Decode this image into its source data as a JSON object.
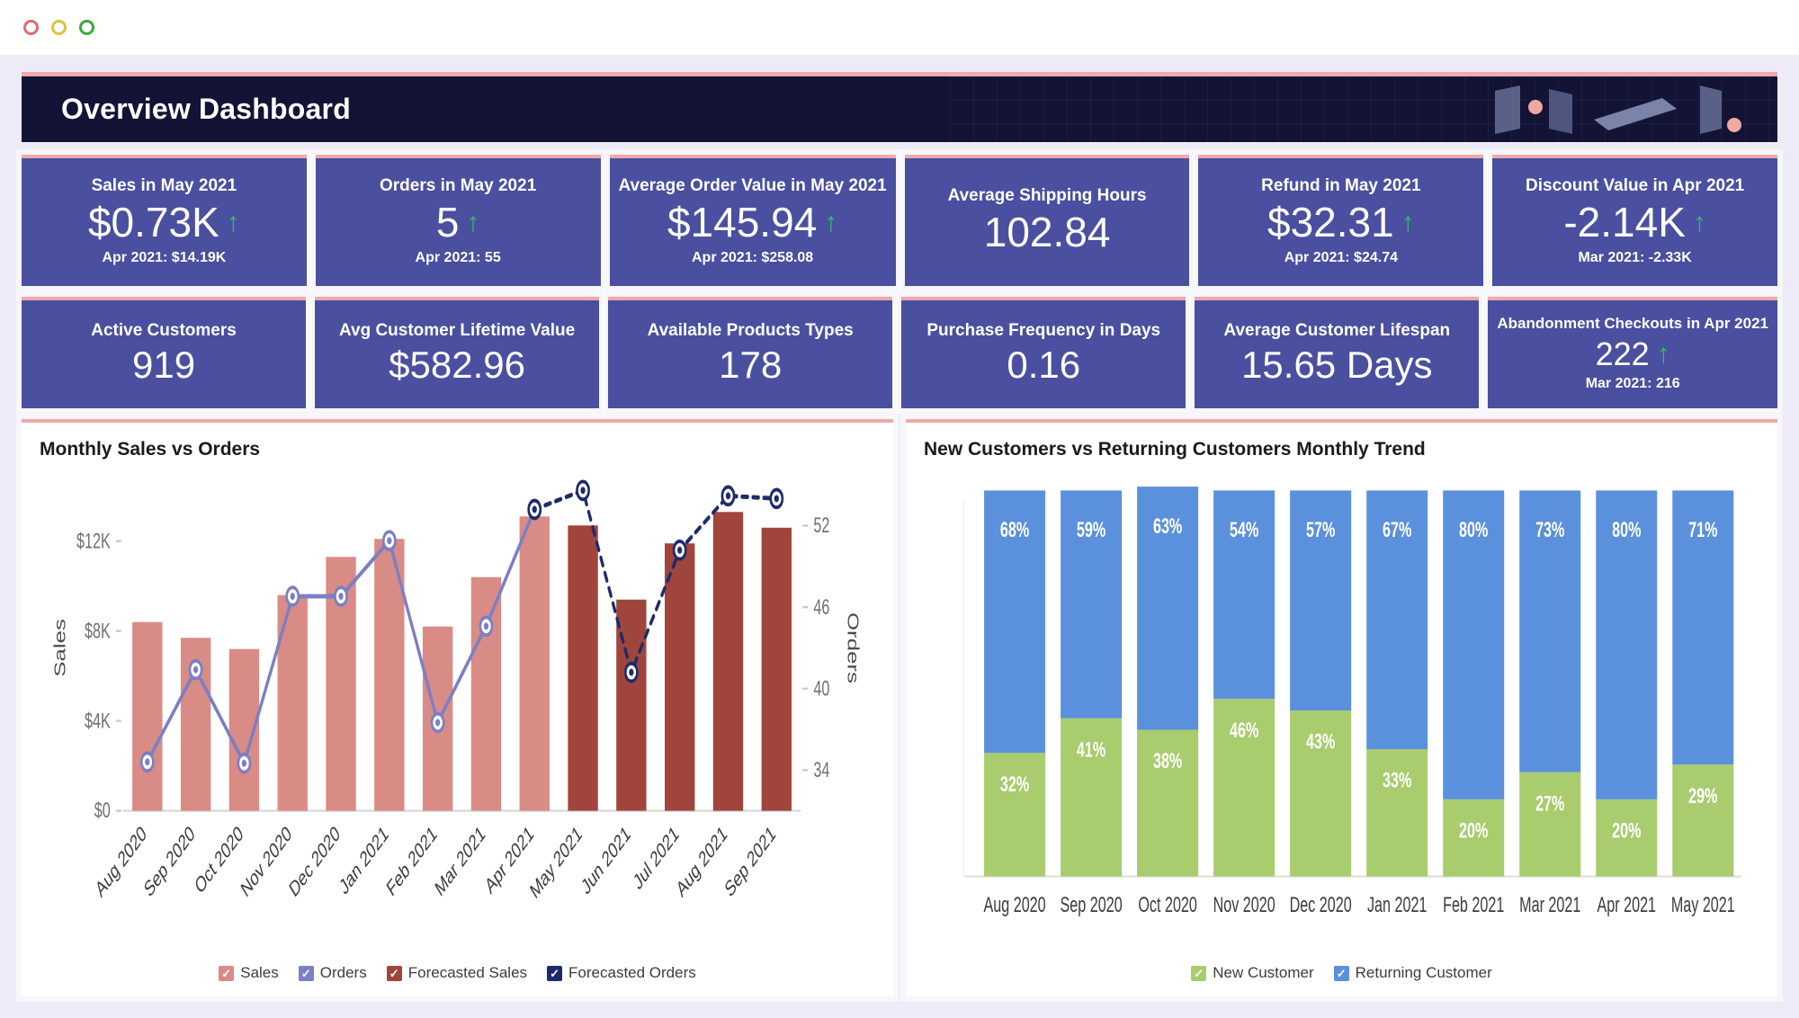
{
  "window": {
    "dots": [
      "close-red",
      "minimize-amber",
      "maximize-green"
    ]
  },
  "header": {
    "title": "Overview Dashboard",
    "accent_color": "#f1a8a8",
    "background_color": "#131336",
    "logo_name": "abstract-geometry-logo"
  },
  "theme": {
    "kpi_bg": "#4a4f9f",
    "kpi_accent": "#f1a8a8",
    "canvas_bg": "#ecebf7",
    "up_arrow_color": "#2fbf63"
  },
  "kpis_row1": [
    {
      "title": "Sales in May 2021",
      "value": "$0.73K",
      "trend": "up",
      "sub": "Apr 2021: $14.19K"
    },
    {
      "title": "Orders in May 2021",
      "value": "5",
      "trend": "up",
      "sub": "Apr 2021: 55"
    },
    {
      "title": "Average Order Value in May 2021",
      "value": "$145.94",
      "trend": "up",
      "sub": "Apr 2021: $258.08"
    },
    {
      "title": "Average Shipping Hours",
      "value": "102.84",
      "trend": "none",
      "sub": ""
    },
    {
      "title": "Refund in May 2021",
      "value": "$32.31",
      "trend": "up",
      "sub": "Apr 2021: $24.74"
    },
    {
      "title": "Discount Value in Apr 2021",
      "value": "-2.14K",
      "trend": "up",
      "sub": "Mar 2021: -2.33K"
    }
  ],
  "kpis_row2": [
    {
      "title": "Active Customers",
      "value": "919",
      "trend": "none",
      "sub": ""
    },
    {
      "title": "Avg Customer Lifetime Value",
      "value": "$582.96",
      "trend": "none",
      "sub": ""
    },
    {
      "title": "Available Products Types",
      "value": "178",
      "trend": "none",
      "sub": ""
    },
    {
      "title": "Purchase Frequency in Days",
      "value": "0.16",
      "trend": "none",
      "sub": ""
    },
    {
      "title": "Average Customer Lifespan",
      "value": "15.65 Days",
      "trend": "none",
      "sub": ""
    },
    {
      "title": "Abandonment Checkouts in Apr 2021",
      "value": "222",
      "trend": "up",
      "sub": "Mar 2021: 216"
    }
  ],
  "chart_data": [
    {
      "type": "bar",
      "title": "Monthly Sales vs Orders",
      "xlabel": "",
      "ylabel": "Sales",
      "y2label": "Orders",
      "categories": [
        "Aug 2020",
        "Sep 2020",
        "Oct 2020",
        "Nov 2020",
        "Dec 2020",
        "Jan 2021",
        "Feb 2021",
        "Mar 2021",
        "Apr 2021",
        "May 2021",
        "Jun 2021",
        "Jul 2021",
        "Aug 2021",
        "Sep 2021"
      ],
      "ylim": [
        0,
        14500
      ],
      "yticks": [
        0,
        4000,
        8000,
        12000
      ],
      "yticklabels": [
        "$0",
        "$4K",
        "$8K",
        "$12K"
      ],
      "y2lim": [
        31,
        55
      ],
      "y2ticks": [
        34,
        40,
        46,
        52
      ],
      "y2ticklabels": [
        "34",
        "40",
        "46",
        "52"
      ],
      "grid": false,
      "legend_position": "bottom",
      "series": [
        {
          "name": "Sales",
          "kind": "bar",
          "color": "#d98b86",
          "values": [
            8400,
            7700,
            7200,
            9600,
            11300,
            12100,
            8200,
            10400,
            13100,
            null,
            null,
            null,
            null,
            null
          ]
        },
        {
          "name": "Forecasted Sales",
          "kind": "bar",
          "color": "#a0453c",
          "values": [
            null,
            null,
            null,
            null,
            null,
            null,
            null,
            null,
            null,
            12700,
            9400,
            11900,
            13300,
            12600
          ]
        },
        {
          "name": "Orders",
          "kind": "line",
          "color": "#7b7fc4",
          "values": [
            34.6,
            41.4,
            34.5,
            46.8,
            46.8,
            50.9,
            37.5,
            44.6,
            53.2,
            null,
            null,
            null,
            null,
            null
          ]
        },
        {
          "name": "Forecasted Orders",
          "kind": "line-dashed",
          "color": "#1d2b6b",
          "values": [
            null,
            null,
            null,
            null,
            null,
            null,
            null,
            null,
            53.2,
            54.6,
            41.2,
            50.2,
            54.2,
            54.0
          ]
        }
      ]
    },
    {
      "type": "bar",
      "subtype": "stacked-100",
      "title": "New Customers vs Returning Customers Monthly Trend",
      "xlabel": "",
      "ylabel": "",
      "categories": [
        "Aug 2020",
        "Sep 2020",
        "Oct 2020",
        "Nov 2020",
        "Dec 2020",
        "Jan 2021",
        "Feb 2021",
        "Mar 2021",
        "Apr 2021",
        "May 2021"
      ],
      "ylim": [
        0,
        100
      ],
      "grid": false,
      "legend_position": "bottom",
      "series": [
        {
          "name": "New Customer",
          "color": "#a8cc6e",
          "values": [
            32,
            41,
            38,
            46,
            43,
            33,
            20,
            27,
            20,
            29
          ],
          "labels": [
            "32%",
            "41%",
            "38%",
            "46%",
            "43%",
            "33%",
            "20%",
            "27%",
            "20%",
            "29%"
          ]
        },
        {
          "name": "Returning Customer",
          "color": "#5b91dc",
          "values": [
            68,
            59,
            63,
            54,
            57,
            67,
            80,
            73,
            80,
            71
          ],
          "labels": [
            "68%",
            "59%",
            "63%",
            "54%",
            "57%",
            "67%",
            "80%",
            "73%",
            "80%",
            "71%"
          ]
        }
      ]
    }
  ],
  "legend_left": [
    {
      "label": "Sales",
      "color": "#d98b86",
      "checked": true
    },
    {
      "label": "Orders",
      "color": "#7b7fc4",
      "checked": true
    },
    {
      "label": "Forecasted Sales",
      "color": "#a0453c",
      "checked": true
    },
    {
      "label": "Forecasted Orders",
      "color": "#1d2b6b",
      "checked": true
    }
  ],
  "legend_right": [
    {
      "label": "New Customer",
      "color": "#a8cc6e",
      "checked": true
    },
    {
      "label": "Returning Customer",
      "color": "#5b91dc",
      "checked": true
    }
  ]
}
